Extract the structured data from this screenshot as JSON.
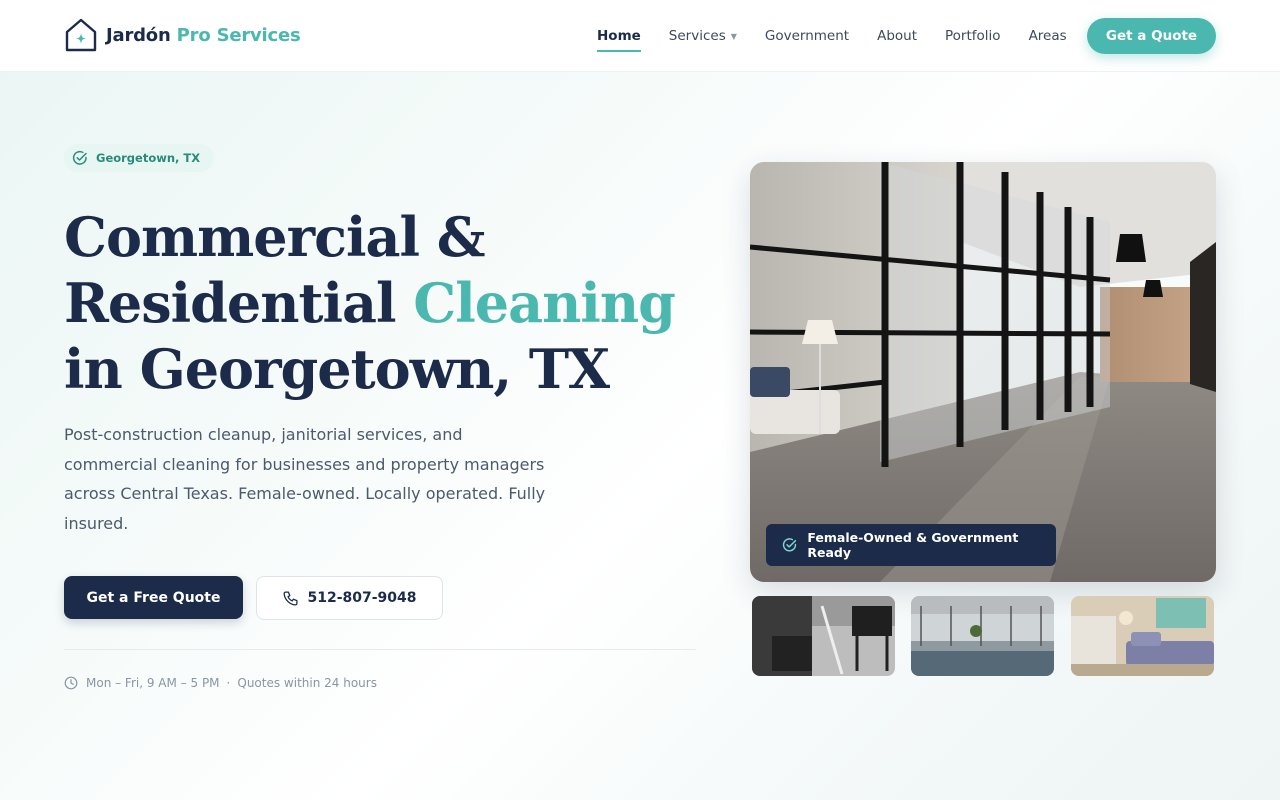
{
  "brand": {
    "name_part1": "Jardón",
    "name_part2": "Pro Services"
  },
  "nav": {
    "items": [
      {
        "label": "Home",
        "active": true
      },
      {
        "label": "Services",
        "dropdown": true
      },
      {
        "label": "Government"
      },
      {
        "label": "About"
      },
      {
        "label": "Portfolio"
      },
      {
        "label": "Areas"
      }
    ],
    "cta_label": "Get a Quote"
  },
  "hero": {
    "badge": "Georgetown, TX",
    "headline": {
      "line1": "Commercial &",
      "line2_part1": "Residential",
      "line2_accent": "Cleaning",
      "line3": "in Georgetown, TX"
    },
    "subtext": "Post-construction cleanup, janitorial services, and commercial cleaning for businesses and property managers across Central Texas. Female-owned. Locally operated. Fully insured.",
    "primary_cta": "Get a Free Quote",
    "phone": "512-807-9048",
    "hours": "Mon – Fri, 9 AM – 5 PM",
    "separator": "·",
    "quote_note": "Quotes within 24 hours",
    "photo_badge": "Female-Owned & Government Ready"
  },
  "colors": {
    "navy": "#1c2b4a",
    "teal": "#4bb8b0",
    "text_muted": "#8a95a5"
  },
  "icons": {
    "logo": "house-sparkle-icon",
    "badge": "check-circle-icon",
    "phone": "phone-icon",
    "clock": "clock-icon"
  }
}
